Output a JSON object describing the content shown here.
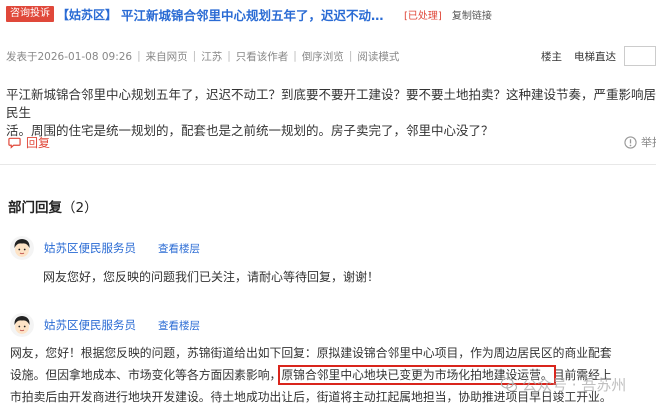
{
  "post": {
    "tag": "咨询投诉",
    "district": "【姑苏区】",
    "title": "平江新城锦合邻里中心规划五年了，迟迟不动工？到底要不要开工建设？",
    "status": "[已处理]",
    "copy_link": "复制链接",
    "meta": {
      "time": "发表于2026-01-08 09:26",
      "source": "来自网页",
      "region": "江苏",
      "only_author": "只看该作者",
      "reverse": "倒序浏览",
      "read_mode": "阅读模式",
      "floor_owner": "楼主",
      "direct": "电梯直达"
    },
    "body_lines": [
      "平江新城锦合邻里中心规划五年了，迟迟不动工？到底要不要开工建设？要不要土地拍卖？这种建设节奏，严重影响居民生",
      "活。周围的住宅是统一规划的，配套也是之前统一规划的。房子卖完了，邻里中心没了？"
    ],
    "reply_btn": "回复",
    "report": "举报"
  },
  "replies_section": {
    "title": "部门回复",
    "count": "（2）"
  },
  "replies": [
    {
      "author": "姑苏区便民服务员",
      "view_floor": "查看楼层",
      "text": "网友您好，您反映的问题我们已关注，请耐心等待回复，谢谢！"
    },
    {
      "author": "姑苏区便民服务员",
      "view_floor": "查看楼层",
      "line1": "网友，您好！根据您反映的问题，苏锦街道给出如下回复：原拟建设锦合邻里中心项目，作为周边居民区的商业配套",
      "line2_before": "设施。但因拿地成本、市场变化等各方面因素影响，",
      "line2_highlight": "原锦合邻里中心地块已变更为市场化拍地建设运营。",
      "line2_after": "目前需经上",
      "line3": "市拍卖后由开发商进行地块开发建设。待土地成功出让后，街道将主动扛起属地担当，协助推进项目早日竣工开业。"
    }
  ],
  "watermark": "公众号 · 吾苏州",
  "colors": {
    "accent_red": "#e0483a",
    "link_blue": "#2a6bd4",
    "highlight_box": "#d9251c"
  }
}
